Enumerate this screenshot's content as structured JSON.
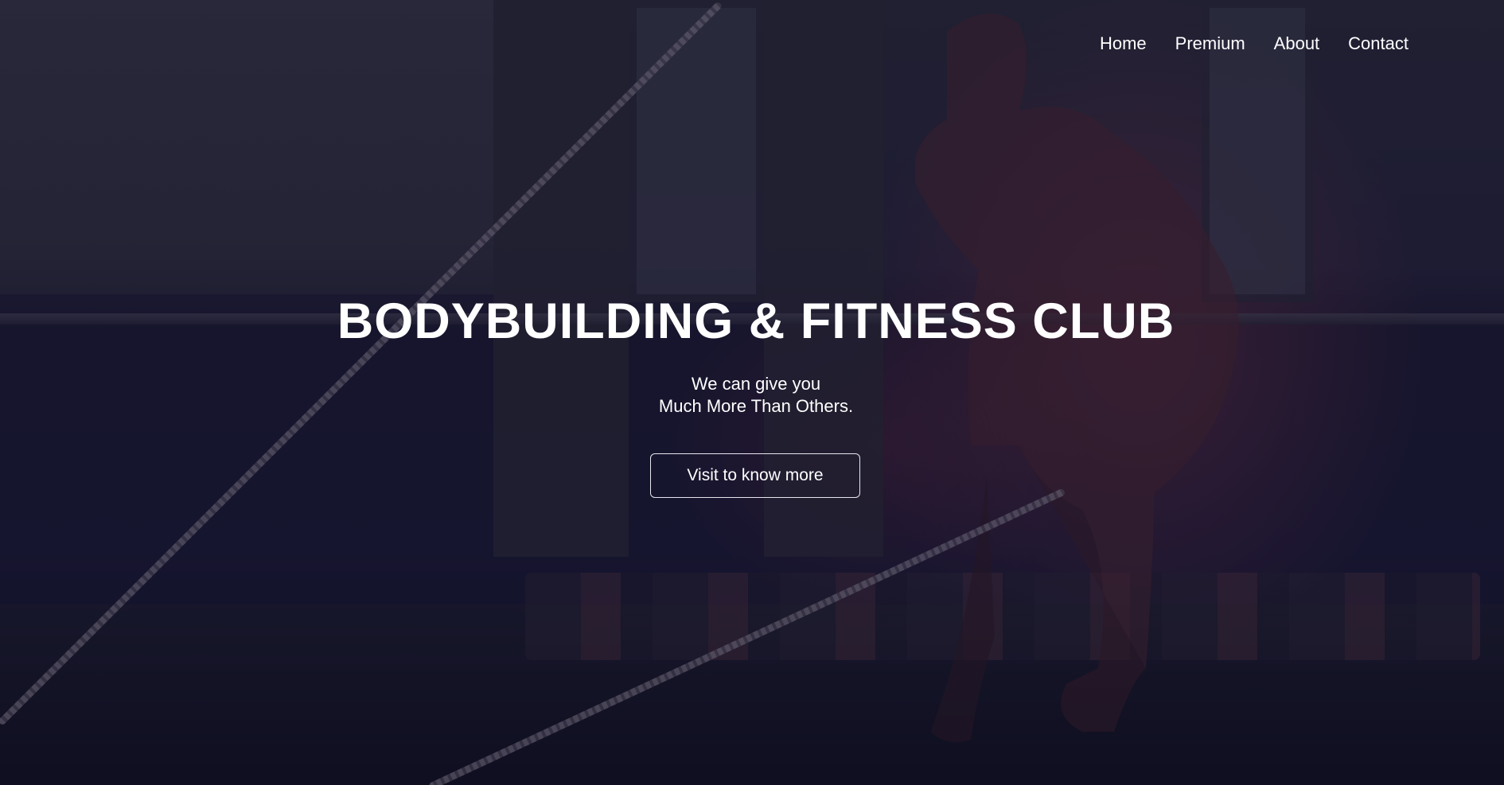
{
  "nav": {
    "items": [
      {
        "label": "Home"
      },
      {
        "label": "Premium"
      },
      {
        "label": "About"
      },
      {
        "label": "Contact"
      }
    ]
  },
  "hero": {
    "title": "BODYBUILDING & FITNESS CLUB",
    "subtitle_line1": "We can give you",
    "subtitle_line2": "Much More Than Others.",
    "cta_label": "Visit to know more",
    "background_image": "gym-athlete-battle-ropes-photo"
  },
  "colors": {
    "overlay": "#14122a",
    "text": "#ffffff",
    "accent_red": "#7a3446"
  }
}
